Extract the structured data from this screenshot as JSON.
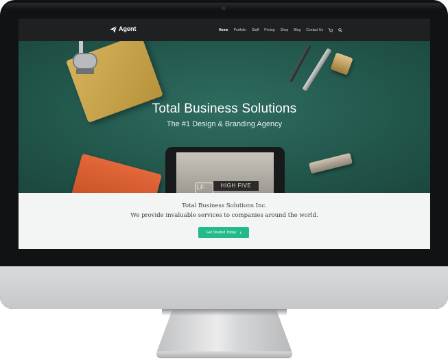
{
  "navbar": {
    "logo_text": "Agent",
    "items": [
      {
        "label": "Home",
        "active": true
      },
      {
        "label": "Portfolio",
        "active": false
      },
      {
        "label": "Staff",
        "active": false
      },
      {
        "label": "Pricing",
        "active": false
      },
      {
        "label": "Shop",
        "active": false
      },
      {
        "label": "Blog",
        "active": false
      },
      {
        "label": "Contact Us",
        "active": false
      }
    ],
    "cart_icon": "cart-icon",
    "search_icon": "search-icon"
  },
  "hero": {
    "title": "Total Business Solutions",
    "subtitle": "The #1 Design & Branding Agency",
    "tablet_text": "HIGH FIVE",
    "tablet_text_small": "LF"
  },
  "content": {
    "line1": "Total Business Solutions Inc.",
    "line2": "We provide invaluable services to companies around the world.",
    "cta_label": "Get Started Today",
    "cta_icon": "chevron-right-icon"
  },
  "colors": {
    "navbar_bg": "#1f2021",
    "hero_bg": "#23584d",
    "accent": "#22b98b",
    "content_bg": "#f3f4f4"
  }
}
